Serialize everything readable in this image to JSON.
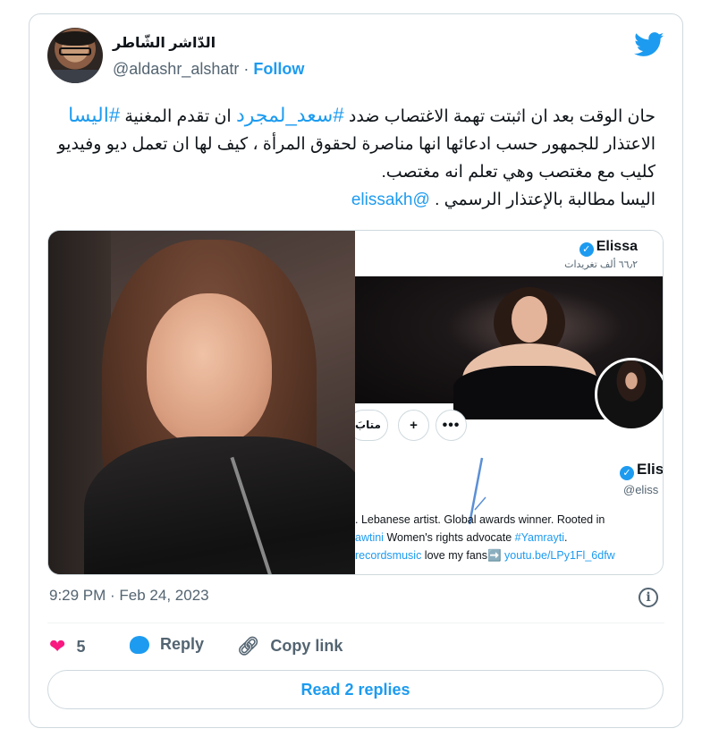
{
  "tweet": {
    "author_name": "الدّاشر الشّاطر",
    "handle": "@aldashr_alshatr",
    "separator": "·",
    "follow_label": "Follow",
    "text": {
      "line1_a": "حان الوقت بعد ان اثبتت تهمة الاغتصاب ضدد ",
      "hashtag1": "#سعد_لمجرد",
      "line1_b": " ان تقدم المغنية",
      "hashtag2": "#اليسا",
      "line2": " الاعتذار للجمهور حسب ادعائها انها مناصرة لحقوق المرأة ، كيف لها ان تعمل ديو وفيديو كليب مع مغتصب وهي تعلم انه مغتصب.",
      "line3": "اليسا مطالبة بالإعتذار الرسمي . ",
      "mention": "@elissakh"
    },
    "timestamp": "9:29 PM · Feb 24, 2023",
    "likes_count": "5",
    "reply_label": "Reply",
    "copy_link_label": "Copy link",
    "read_replies_label": "Read 2 replies"
  },
  "embedded_screenshot": {
    "profile_name": "Elissa",
    "tweets_count": "٦٦٫٢ ألف تغريدات",
    "follow_button": "متابَ",
    "more_glyph": "•••",
    "bell_glyph": "+",
    "name_cut": "Elis",
    "handle_cut": "@eliss",
    "bio_line1": ". Lebanese artist. Global awards winner. Rooted in",
    "bio_line2_a": "awtini",
    "bio_line2_b": " Women's rights advocate ",
    "bio_line2_tag": "#Yamrayti",
    "bio_line2_c": ".",
    "bio_line3_a": "recordsmusic",
    "bio_line3_b": " love my fans",
    "bio_line3_link": "➡️ youtu.be/LPy1Fl_6dfw"
  },
  "icons": {
    "brand": "twitter-bird-icon",
    "info": "info-icon",
    "heart": "heart-icon",
    "reply": "reply-bubble-icon",
    "copy": "link-icon",
    "verified": "verified-badge-icon"
  },
  "colors": {
    "accent": "#1d9bf0",
    "like": "#f91880",
    "muted": "#536471",
    "border": "#cfd9de"
  }
}
